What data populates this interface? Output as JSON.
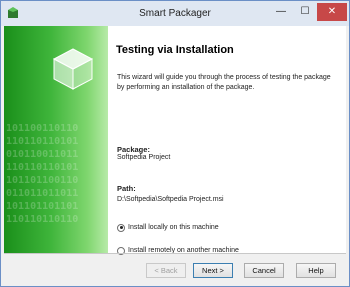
{
  "window": {
    "title": "Smart Packager",
    "controls": {
      "minimize": "—",
      "maximize": "☐",
      "close": "✕"
    }
  },
  "sidebar": {
    "binary_pattern": "101100110110\n110110110101\n010110011011\n110110110101\n101101100110\n011011011011\n101101101101\n110110110110"
  },
  "content": {
    "heading": "Testing via Installation",
    "intro": "This wizard will guide you through the process of testing the package by performing an installation of the package.",
    "package_label": "Package:",
    "package_value": "Softpedia Project",
    "path_label": "Path:",
    "path_value": "D:\\Softpedia\\Softpedia Project.msi",
    "options": [
      {
        "label": "Install locally on this machine",
        "selected": true
      },
      {
        "label": "Install remotely on another machine",
        "selected": false
      }
    ]
  },
  "buttons": {
    "back": "< Back",
    "next": "Next >",
    "cancel": "Cancel",
    "help": "Help"
  },
  "colors": {
    "sidebar_green": "#3fb53b",
    "close_red": "#c74848"
  }
}
